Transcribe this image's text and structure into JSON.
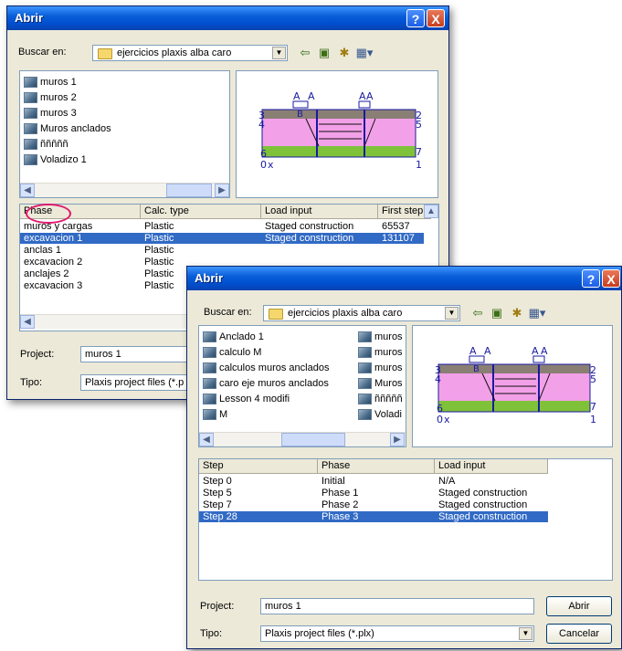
{
  "dialog_back": {
    "title": "Abrir",
    "help_label": "?",
    "close_label": "X",
    "look_in_label": "Buscar en:",
    "look_in_value": "ejercicios plaxis alba caro",
    "files": [
      "muros 1",
      "muros 2",
      "muros 3",
      "Muros anclados",
      "ñññññ",
      "Voladizo 1"
    ],
    "grid_headers": [
      "Phase",
      "Calc. type",
      "Load input",
      "First step"
    ],
    "grid_rows": [
      [
        "muros y cargas",
        "Plastic",
        "Staged construction",
        "65537"
      ],
      [
        "excavacion 1",
        "Plastic",
        "Staged construction",
        "131107"
      ],
      [
        "anclas 1",
        "Plastic",
        "",
        ""
      ],
      [
        "excavacion 2",
        "Plastic",
        "",
        ""
      ],
      [
        "anclajes 2",
        "Plastic",
        "",
        ""
      ],
      [
        "excavacion 3",
        "Plastic",
        "",
        ""
      ]
    ],
    "project_label": "Project:",
    "project_value": "muros 1",
    "type_label": "Tipo:",
    "type_value": "Plaxis project files (*.p"
  },
  "dialog_front": {
    "title": "Abrir",
    "help_label": "?",
    "close_label": "X",
    "look_in_label": "Buscar en:",
    "look_in_value": "ejercicios plaxis alba caro",
    "files_col1": [
      "Anclado 1",
      "calculo M",
      "calculos muros anclados",
      "caro eje muros anclados",
      "Lesson 4 modifi",
      "M"
    ],
    "files_col2": [
      "muros",
      "muros",
      "muros",
      "Muros",
      "ñññññ",
      "Voladi"
    ],
    "grid_headers": [
      "Step",
      "Phase",
      "Load input"
    ],
    "grid_rows": [
      [
        "Step 0",
        "Initial",
        "N/A"
      ],
      [
        "Step 5",
        "Phase 1",
        "Staged construction"
      ],
      [
        "Step 7",
        "Phase 2",
        "Staged construction"
      ],
      [
        "Step 28",
        "Phase 3",
        "Staged construction"
      ]
    ],
    "project_label": "Project:",
    "project_value": "muros 1",
    "type_label": "Tipo:",
    "type_value": "Plaxis project files (*.plx)",
    "open_button": "Abrir",
    "cancel_button": "Cancelar"
  },
  "preview_labels": {
    "load_a": "A",
    "load_b": "B",
    "corner_0": "0",
    "corner_1": "1",
    "corner_2": "2",
    "corner_3": "3",
    "corner_4": "4",
    "corner_5": "5",
    "corner_6": "6",
    "corner_7": "7",
    "axis_x": "x"
  }
}
